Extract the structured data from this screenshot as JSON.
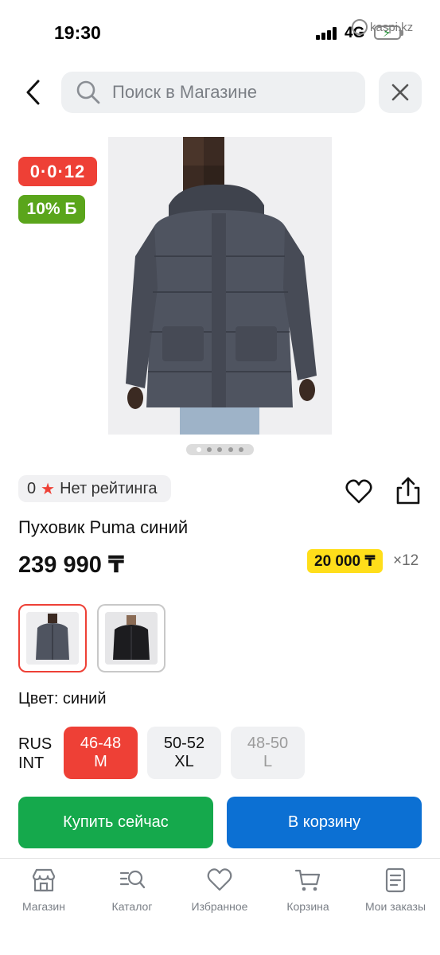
{
  "status_bar": {
    "time": "19:30",
    "network": "4G",
    "watermark": "kaspi.kz"
  },
  "header": {
    "search_placeholder": "Поиск в Магазине"
  },
  "badges": {
    "installment": "0·0·12",
    "bonus": "10% Б"
  },
  "gallery": {
    "total_images": 5,
    "active_index": 0
  },
  "rating": {
    "value": "0",
    "text": "Нет рейтинга"
  },
  "product": {
    "title": "Пуховик Puma синий",
    "price": "239 990 ₸",
    "monthly_payment": "20 000 ₸",
    "months": "×12"
  },
  "variants": [
    {
      "name": "blue",
      "selected": true
    },
    {
      "name": "black",
      "selected": false
    }
  ],
  "color": {
    "label": "Цвет: синий"
  },
  "size": {
    "label_line1": "RUS",
    "label_line2": "INT",
    "options": [
      {
        "rus": "46-48",
        "int": "M",
        "state": "selected"
      },
      {
        "rus": "50-52",
        "int": "XL",
        "state": "available"
      },
      {
        "rus": "48-50",
        "int": "L",
        "state": "disabled"
      }
    ]
  },
  "actions": {
    "buy_now": "Купить сейчас",
    "add_to_cart": "В корзину"
  },
  "bottom_nav": [
    {
      "label": "Магазин",
      "icon": "store-icon"
    },
    {
      "label": "Каталог",
      "icon": "catalog-icon"
    },
    {
      "label": "Избранное",
      "icon": "heart-icon"
    },
    {
      "label": "Корзина",
      "icon": "cart-icon"
    },
    {
      "label": "Мои заказы",
      "icon": "orders-icon"
    }
  ],
  "colors": {
    "red": "#ee4036",
    "green": "#15a94c",
    "blue": "#0c70d3",
    "yellow": "#ffde1a",
    "bonus_green": "#5aa51b"
  }
}
